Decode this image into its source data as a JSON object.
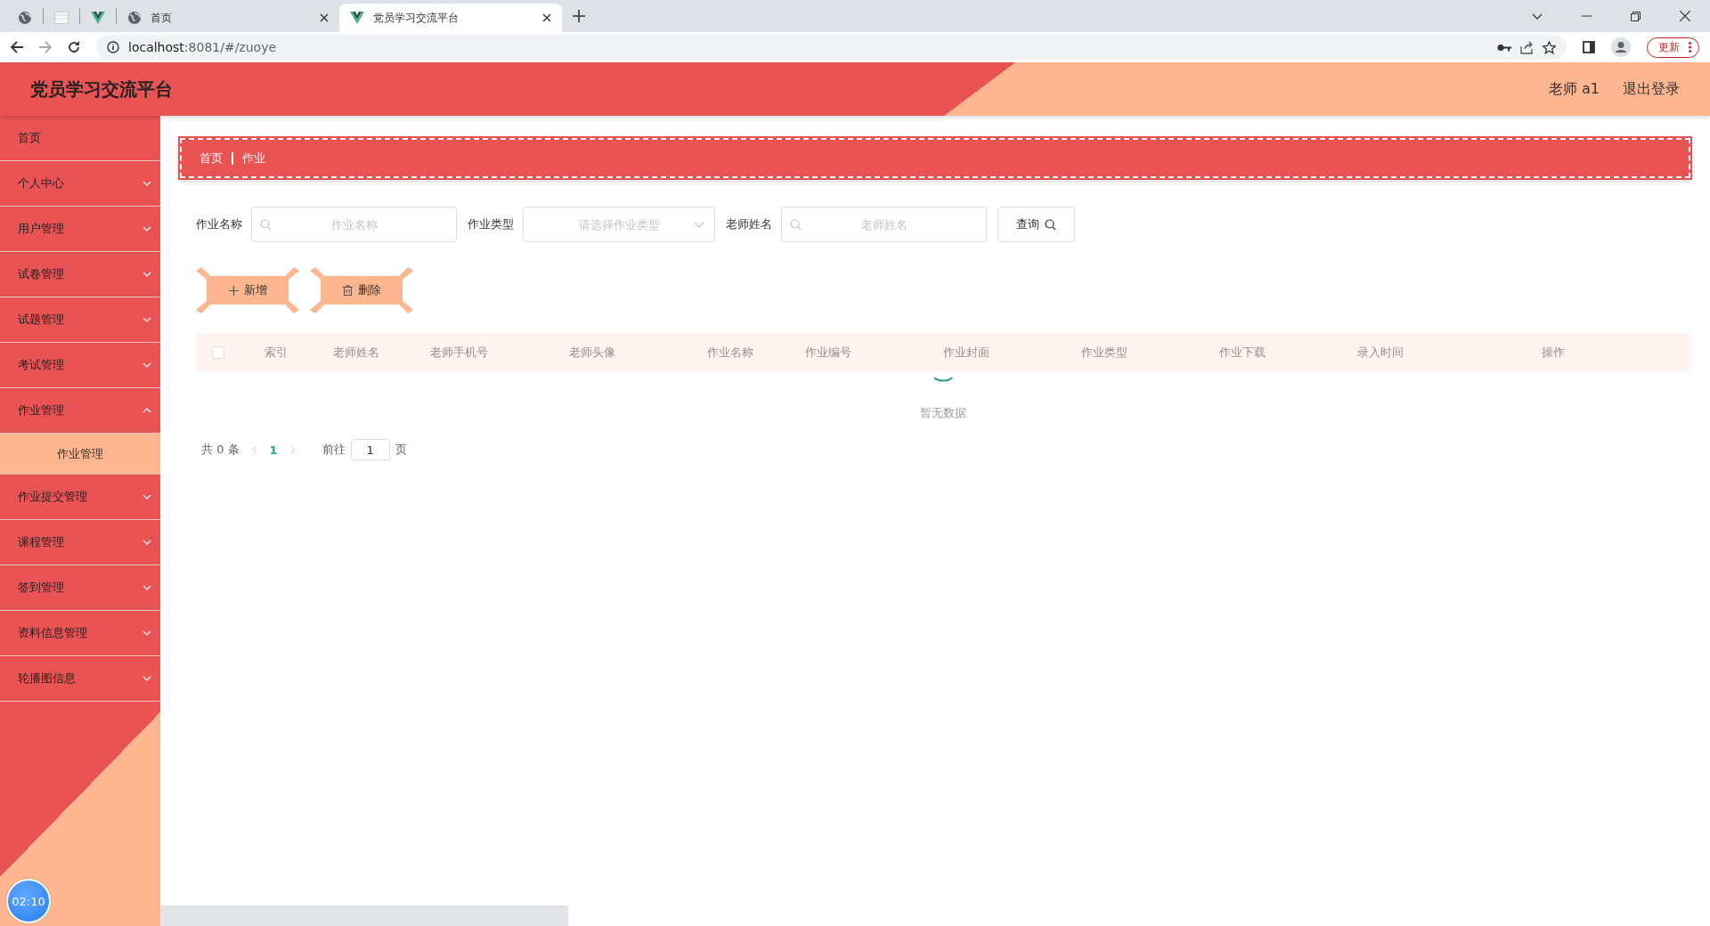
{
  "browser": {
    "tabs": [
      {
        "kind": "globe",
        "selected": false
      },
      {
        "kind": "page",
        "selected": false
      },
      {
        "kind": "vue",
        "selected": false
      },
      {
        "kind": "globe",
        "title": "首页",
        "selected": false
      },
      {
        "kind": "vue",
        "title": "党员学习交流平台",
        "selected": true
      }
    ],
    "forward_disabled": true,
    "url_host": "localhost",
    "url_rest": ":8081/#/zuoye",
    "update_button": "更新"
  },
  "header": {
    "title": "党员学习交流平台",
    "user": "老师 a1",
    "logout": "退出登录"
  },
  "sidebar": {
    "items": [
      {
        "kind": "link",
        "label": "首页"
      },
      {
        "kind": "menu",
        "label": "个人中心",
        "expanded": false
      },
      {
        "kind": "menu",
        "label": "用户管理",
        "expanded": false
      },
      {
        "kind": "menu",
        "label": "试卷管理",
        "expanded": false
      },
      {
        "kind": "menu",
        "label": "试题管理",
        "expanded": false
      },
      {
        "kind": "menu",
        "label": "考试管理",
        "expanded": false
      },
      {
        "kind": "menu",
        "label": "作业管理",
        "expanded": true,
        "children": [
          {
            "label": "作业管理",
            "selected": true
          }
        ]
      },
      {
        "kind": "menu",
        "label": "作业提交管理",
        "expanded": false
      },
      {
        "kind": "menu",
        "label": "课程管理",
        "expanded": false
      },
      {
        "kind": "menu",
        "label": "签到管理",
        "expanded": false
      },
      {
        "kind": "menu",
        "label": "资料信息管理",
        "expanded": false
      },
      {
        "kind": "menu",
        "label": "轮播图信息",
        "expanded": false
      }
    ]
  },
  "breadcrumb": [
    "首页",
    "作业"
  ],
  "search": {
    "fields": [
      {
        "kind": "input",
        "label": "作业名称",
        "placeholder": "作业名称"
      },
      {
        "kind": "select",
        "label": "作业类型",
        "placeholder": "请选择作业类型"
      },
      {
        "kind": "input",
        "label": "老师姓名",
        "placeholder": "老师姓名"
      }
    ],
    "button": "查询"
  },
  "actions": [
    {
      "kind": "add",
      "label": "新增"
    },
    {
      "kind": "delete",
      "label": "删除"
    }
  ],
  "table": {
    "select_all_checked": false,
    "columns": [
      "索引",
      "老师姓名",
      "老师手机号",
      "老师头像",
      "作业名称",
      "作业编号",
      "作业封面",
      "作业类型",
      "作业下载",
      "录入时间",
      "操作"
    ],
    "loading": true,
    "empty_text": "暂无数据"
  },
  "pagination": {
    "total": "共 0 条",
    "pages": [
      {
        "label": "1",
        "selected": true
      }
    ],
    "goto_label": "前往",
    "goto_value": "1",
    "goto_unit": "页"
  },
  "timer": "02:10"
}
